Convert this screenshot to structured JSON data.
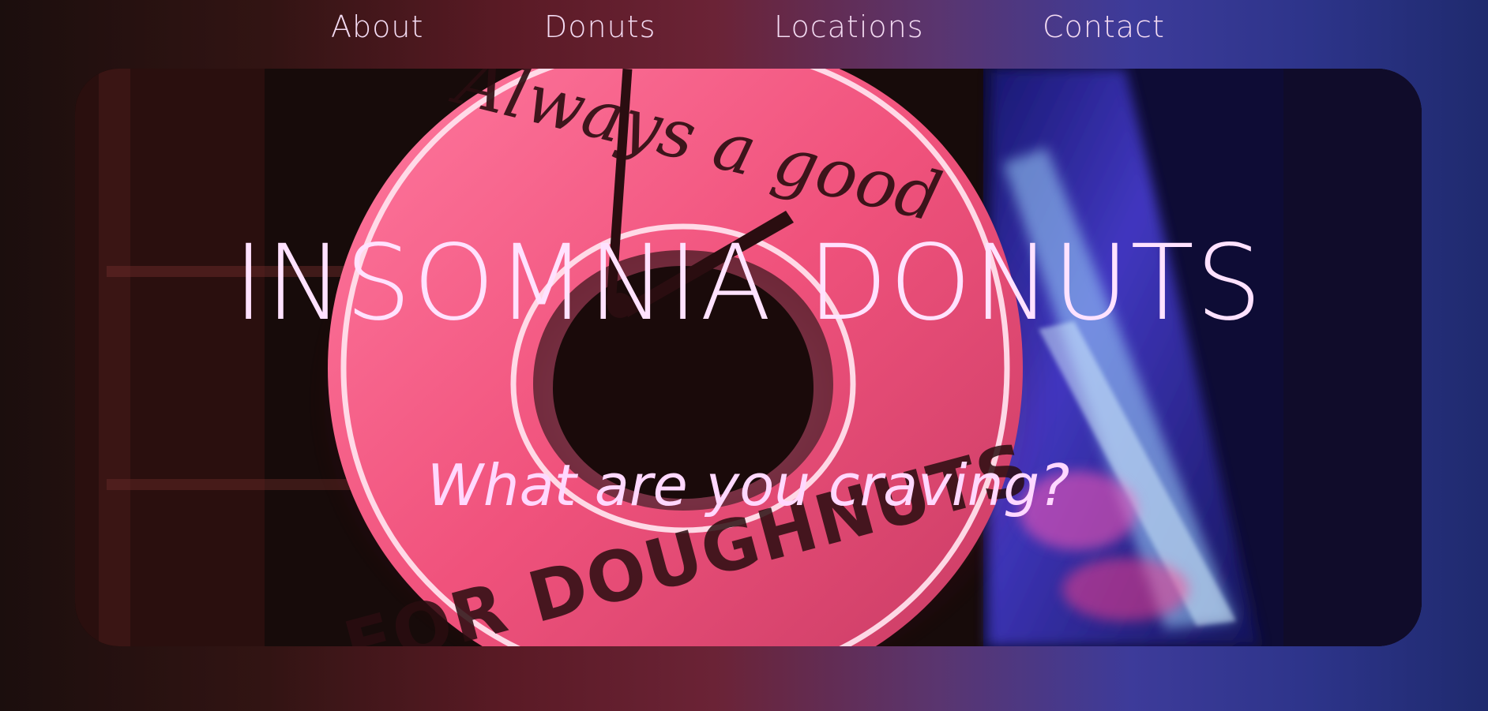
{
  "nav": {
    "items": [
      {
        "id": "about",
        "label": "About"
      },
      {
        "id": "donuts",
        "label": "Donuts"
      },
      {
        "id": "locations",
        "label": "Locations"
      },
      {
        "id": "contact",
        "label": "Contact"
      }
    ]
  },
  "hero": {
    "title": "INSOMNIA DONUTS",
    "subtitle": "What are you craving?",
    "image_description_icon": "neon-donut-sign-image",
    "sign_text_top": "Always a good",
    "sign_text_bottom": "FOR DOUGHNUTS"
  },
  "colors": {
    "nav_text": "#f3dbf2",
    "title_text": "#ffe2ff",
    "neon_pink": "#ff5f9e",
    "neon_blue": "#6a5cff",
    "background_left": "#1b0e0d",
    "background_right": "#1f2a6e"
  }
}
